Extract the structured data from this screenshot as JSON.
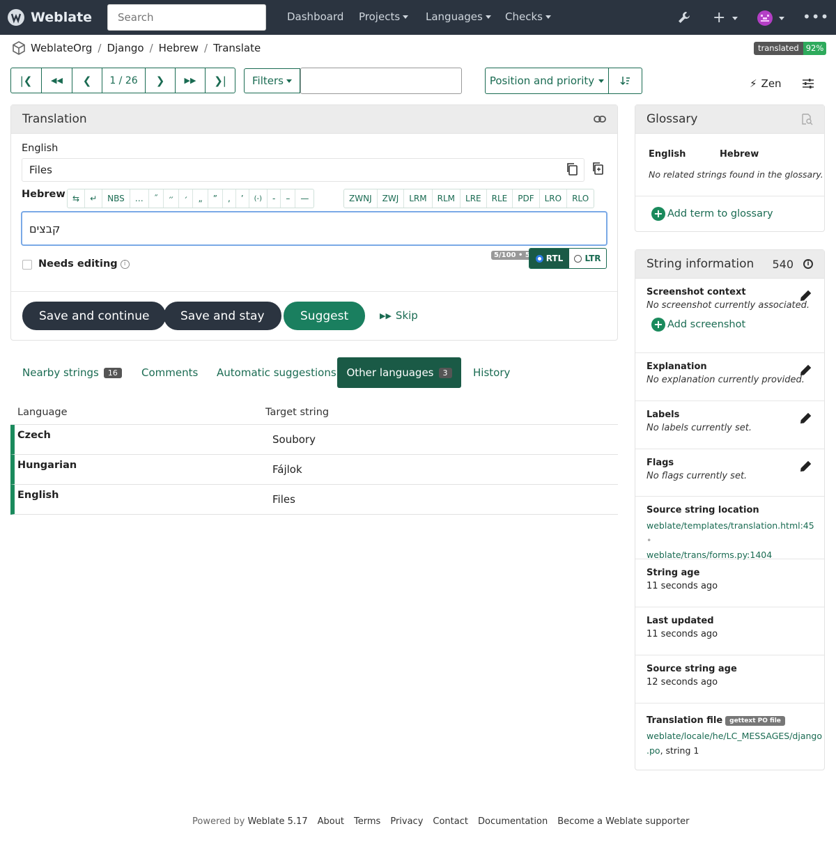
{
  "navbar": {
    "brand": "Weblate",
    "search_placeholder": "Search",
    "links": [
      "Dashboard",
      "Projects",
      "Languages",
      "Checks"
    ]
  },
  "breadcrumb": [
    "WeblateOrg",
    "Django",
    "Hebrew",
    "Translate"
  ],
  "status_badge": {
    "label": "translated",
    "value": "92%"
  },
  "pager": {
    "position": "1 / 26"
  },
  "toolbar": {
    "filters_label": "Filters",
    "sort_label": "Position and priority",
    "zen_label": "Zen"
  },
  "translation": {
    "title": "Translation",
    "source_lang": "English",
    "source_text": "Files",
    "target_lang": "Hebrew",
    "special_chars": [
      "⇆",
      "↵",
      "NBS",
      "…",
      "˝",
      "״",
      "׳",
      "„",
      "”",
      "‚",
      "’",
      "(-)",
      "-",
      "–",
      "—",
      "ZWNJ",
      "ZWJ",
      "LRM",
      "RLM",
      "LRE",
      "RLE",
      "PDF",
      "LRO",
      "RLO"
    ],
    "target_text": "קבצים",
    "char_counter": "5/100 • 5",
    "rtl_label": "RTL",
    "ltr_label": "LTR",
    "needs_editing_label": "Needs editing",
    "save_continue": "Save and continue",
    "save_stay": "Save and stay",
    "suggest": "Suggest",
    "skip": "Skip"
  },
  "tabs": [
    {
      "label": "Nearby strings",
      "count": "16"
    },
    {
      "label": "Comments"
    },
    {
      "label": "Automatic suggestions"
    },
    {
      "label": "Other languages",
      "count": "3"
    },
    {
      "label": "History"
    }
  ],
  "other_languages": {
    "headers": [
      "Language",
      "Target string"
    ],
    "rows": [
      {
        "language": "Czech",
        "target": "Soubory"
      },
      {
        "language": "Hungarian",
        "target": "Fájlok"
      },
      {
        "language": "English",
        "target": "Files"
      }
    ]
  },
  "glossary": {
    "title": "Glossary",
    "col_source": "English",
    "col_target": "Hebrew",
    "empty_text": "No related strings found in the glossary.",
    "add_term": "Add term to glossary"
  },
  "string_info": {
    "title": "String information",
    "id": "540",
    "screenshot_title": "Screenshot context",
    "screenshot_desc": "No screenshot currently associated.",
    "add_screenshot": "Add screenshot",
    "explanation_title": "Explanation",
    "explanation_desc": "No explanation currently provided.",
    "labels_title": "Labels",
    "labels_desc": "No labels currently set.",
    "flags_title": "Flags",
    "flags_desc": "No flags currently set.",
    "location_title": "Source string location",
    "location_1": "weblate/templates/translation.html:45",
    "location_sep": "•",
    "location_2": "weblate/trans/forms.py:1404",
    "age_title": "String age",
    "age_value": "11 seconds ago",
    "updated_title": "Last updated",
    "updated_value": "11 seconds ago",
    "source_age_title": "Source string age",
    "source_age_value": "12 seconds ago",
    "file_title": "Translation file",
    "file_badge": "gettext PO file",
    "file_path_1": "weblate/locale/he/LC_MESSAGES/django",
    "file_path_2": ".po",
    "file_suffix": ", string 1"
  },
  "footer": {
    "powered_prefix": "Powered by",
    "powered_link": "Weblate 5.17",
    "links": [
      "About",
      "Terms",
      "Privacy",
      "Contact",
      "Documentation",
      "Become a Weblate supporter"
    ]
  }
}
